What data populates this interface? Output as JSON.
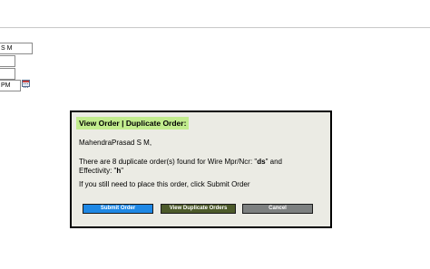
{
  "background_form": {
    "name_value": "S M",
    "time_value": "PM",
    "calendar_icon": "calendar-icon"
  },
  "dialog": {
    "title": "View Order | Duplicate Order:",
    "greeting": "MahendraPrasad S M,",
    "message_prefix": "There are 8 duplicate order(s) found for Wire Mpr/Ncr: \"",
    "mpr_value": "ds",
    "message_mid": "\" and",
    "effectivity_prefix": "Effectivity: \"",
    "effectivity_value": "h",
    "effectivity_suffix": "\"",
    "instruction": "If you still need to place this order, click Submit Order",
    "buttons": {
      "submit": "Submit Order",
      "view_duplicates": "View Duplicate Orders",
      "cancel": "Cancel"
    },
    "colors": {
      "title_highlight": "#c2ec8e",
      "dialog_bg": "#ebebe4",
      "submit_button": "#1e88e5",
      "view_button": "#4c5a2a",
      "cancel_button": "#7d8080"
    }
  }
}
